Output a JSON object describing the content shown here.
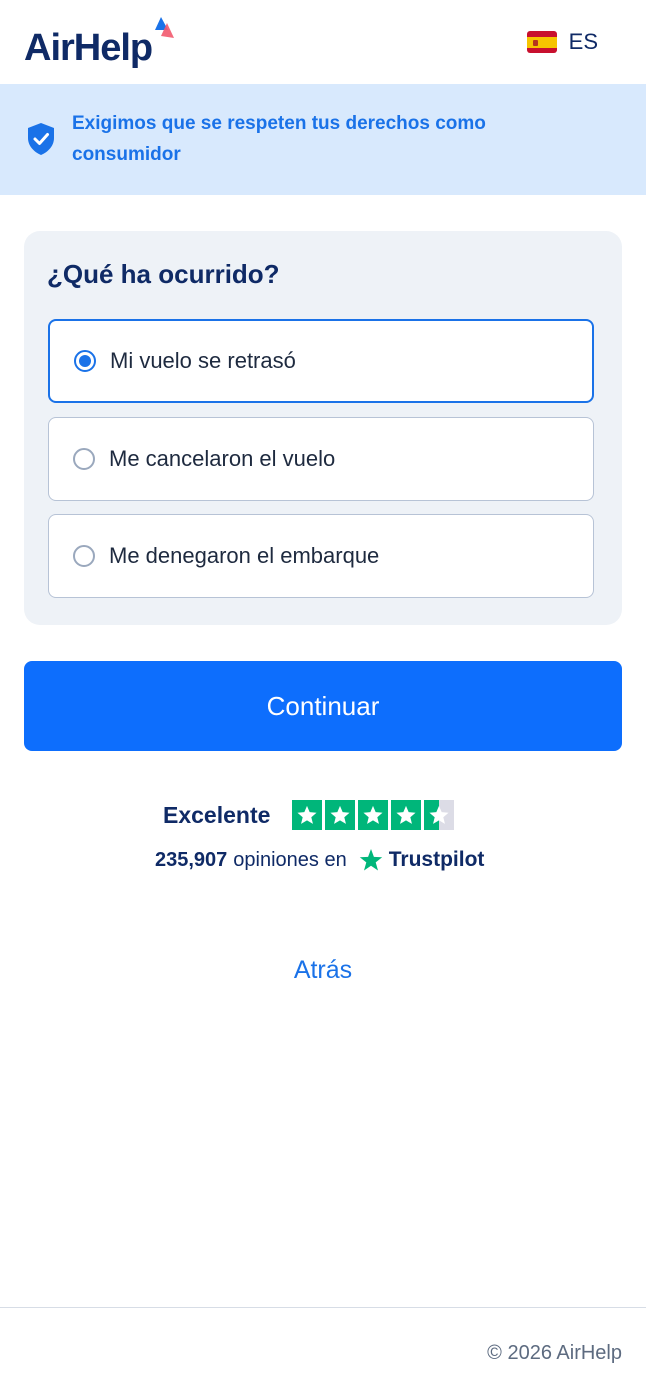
{
  "header": {
    "logo_text": "AirHelp",
    "language": "ES",
    "flag_icon": "spain-flag-icon"
  },
  "banner": {
    "icon": "shield-check-icon",
    "text": "Exigimos que se respeten tus derechos como consumidor"
  },
  "form": {
    "title": "¿Qué ha ocurrido?",
    "options": [
      {
        "label": "Mi vuelo se retrasó",
        "selected": true
      },
      {
        "label": "Me cancelaron el vuelo",
        "selected": false
      },
      {
        "label": "Me denegaron el embarque",
        "selected": false
      }
    ],
    "continue_label": "Continuar"
  },
  "rating": {
    "label": "Excelente",
    "stars": 4.5,
    "reviews_count": "235,907",
    "reviews_text": "opiniones en",
    "provider": "Trustpilot"
  },
  "back_label": "Atrás",
  "footer": {
    "copyright": "© 2026 AirHelp"
  },
  "colors": {
    "brand_blue": "#0d6efd",
    "navy": "#0f2a66",
    "banner_bg": "#d8e9fd",
    "trustpilot_green": "#00b67a"
  }
}
